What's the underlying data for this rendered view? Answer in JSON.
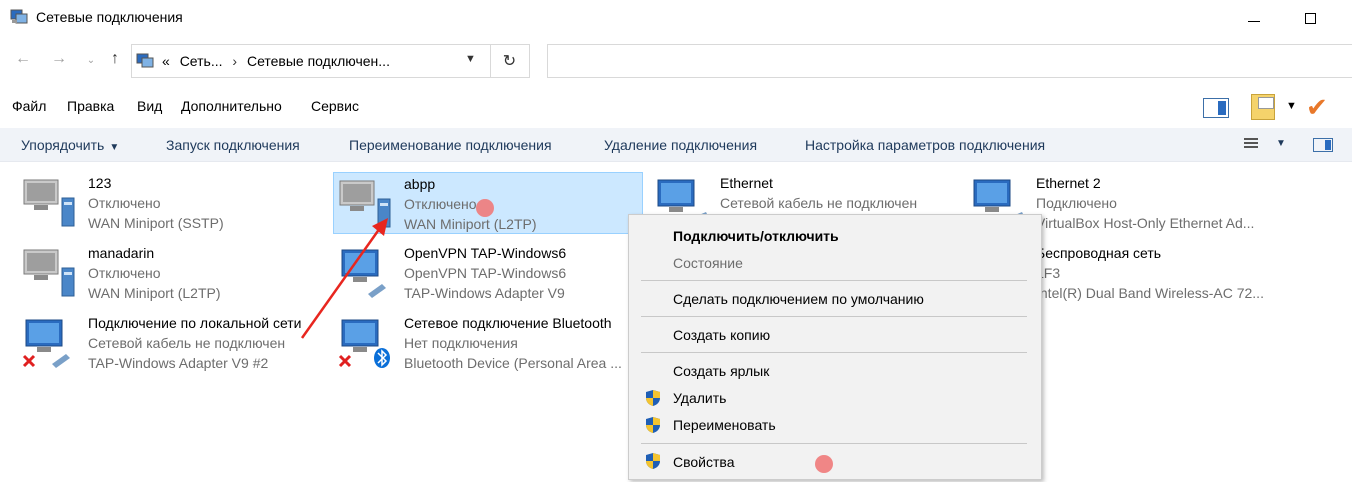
{
  "window": {
    "title": "Сетевые подключения"
  },
  "address": {
    "overflow": "«",
    "crumb1": "Сеть...",
    "separator": "›",
    "crumb2": "Сетевые подключен...",
    "search_placeholder": ""
  },
  "menu": [
    "Файл",
    "Правка",
    "Вид",
    "Дополнительно",
    "Сервис"
  ],
  "commands": {
    "organize": "Упорядочить",
    "start": "Запуск подключения",
    "rename": "Переименование подключения",
    "delete": "Удаление подключения",
    "settings": "Настройка параметров подключения"
  },
  "connections": [
    {
      "name": "123",
      "status": "Отключено",
      "device": "WAN Miniport (SSTP)",
      "icon": "wan-miniport-icon"
    },
    {
      "name": "abpp",
      "status": "Отключено",
      "device": "WAN Miniport (L2TP)",
      "icon": "wan-miniport-icon",
      "selected": true
    },
    {
      "name": "Ethernet",
      "status": "Сетевой кабель не подключен",
      "device": "",
      "icon": "ethernet-adapter-icon"
    },
    {
      "name": "Ethernet 2",
      "status": "Подключено",
      "device": "VirtualBox Host-Only Ethernet Ad...",
      "icon": "ethernet-adapter-icon"
    },
    {
      "name": "manadarin",
      "status": "Отключено",
      "device": "WAN Miniport (L2TP)",
      "icon": "wan-miniport-icon"
    },
    {
      "name": "OpenVPN TAP-Windows6",
      "status": "OpenVPN TAP-Windows6",
      "device": "TAP-Windows Adapter V9",
      "icon": "ethernet-adapter-icon"
    },
    {
      "name": "Беспроводная сеть",
      "status": "LF3",
      "device": "Intel(R) Dual Band Wireless-AC 72...",
      "icon": "wireless-adapter-icon"
    },
    {
      "name": "Подключение по локальной сети",
      "status": "Сетевой кабель не подключен",
      "device": "TAP-Windows Adapter V9 #2",
      "icon": "ethernet-adapter-icon",
      "error": true
    },
    {
      "name": "Сетевое подключение Bluetooth",
      "status": "Нет подключения",
      "device": "Bluetooth Device (Personal Area ...",
      "icon": "bluetooth-adapter-icon",
      "error": true
    }
  ],
  "context_menu": {
    "connect": "Подключить/отключить",
    "status": "Состояние",
    "set_default": "Сделать подключением по умолчанию",
    "copy": "Создать копию",
    "shortcut": "Создать ярлык",
    "delete": "Удалить",
    "rename": "Переименовать",
    "properties": "Свойства"
  },
  "colors": {
    "selection_bg": "#cce8ff",
    "command_text": "#1e395b",
    "annotation": "#f07a7a",
    "arrow": "#e8261f"
  }
}
